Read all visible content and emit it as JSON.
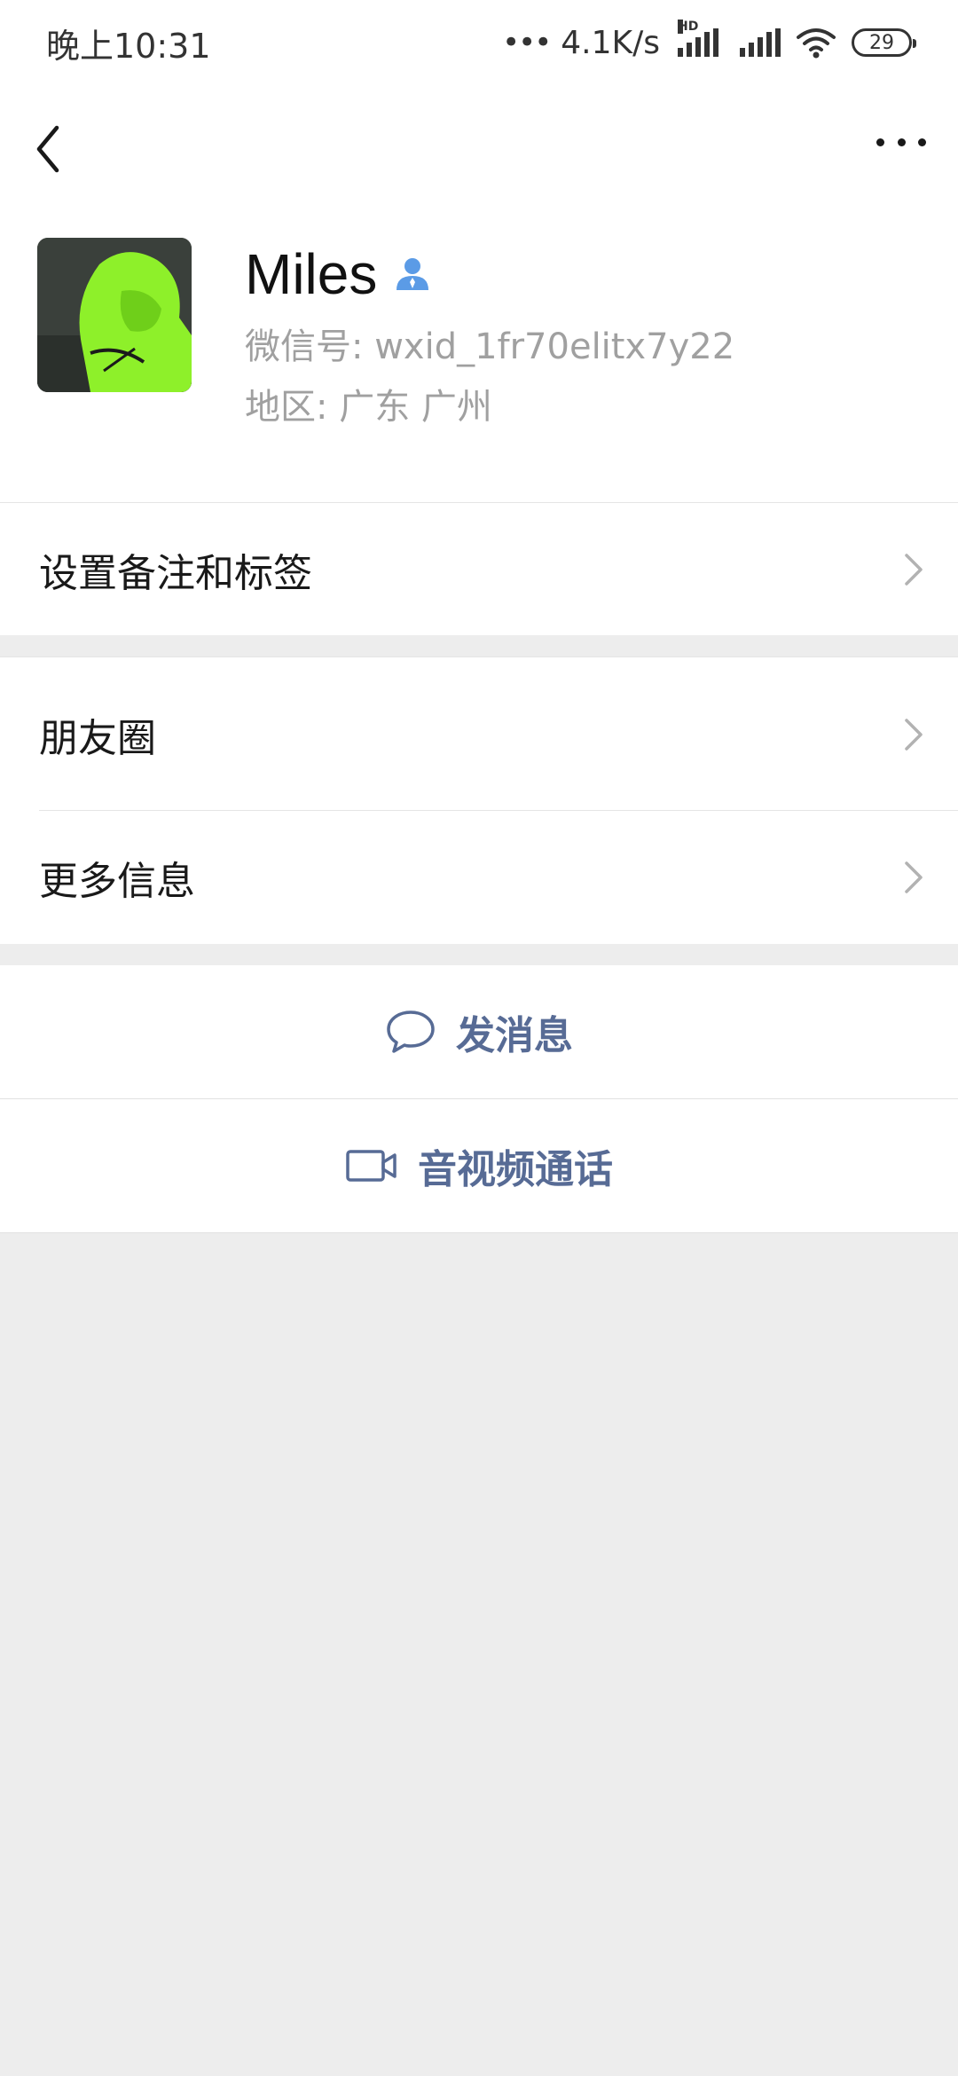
{
  "status_bar": {
    "time": "晚上10:31",
    "dots": "•••",
    "speed": "4.1K/s",
    "hd_label": "HD",
    "battery": "29"
  },
  "header": {
    "back_icon": "chevron-left-icon",
    "more_icon": "more-dots-icon"
  },
  "profile": {
    "name": "Miles",
    "wechat_id": "微信号: wxid_1fr70elitx7y22",
    "region": "地区: 广东  广州",
    "contact_icon": "person-icon",
    "accent_color": "#5b9be6"
  },
  "menu": {
    "set_remark": "设置备注和标签",
    "moments": "朋友圈",
    "more_info": "更多信息"
  },
  "actions": {
    "send_message": "发消息",
    "send_message_icon": "chat-bubble-icon",
    "av_call": "音视频通话",
    "av_call_icon": "video-camera-icon",
    "link_color": "#576b95"
  }
}
